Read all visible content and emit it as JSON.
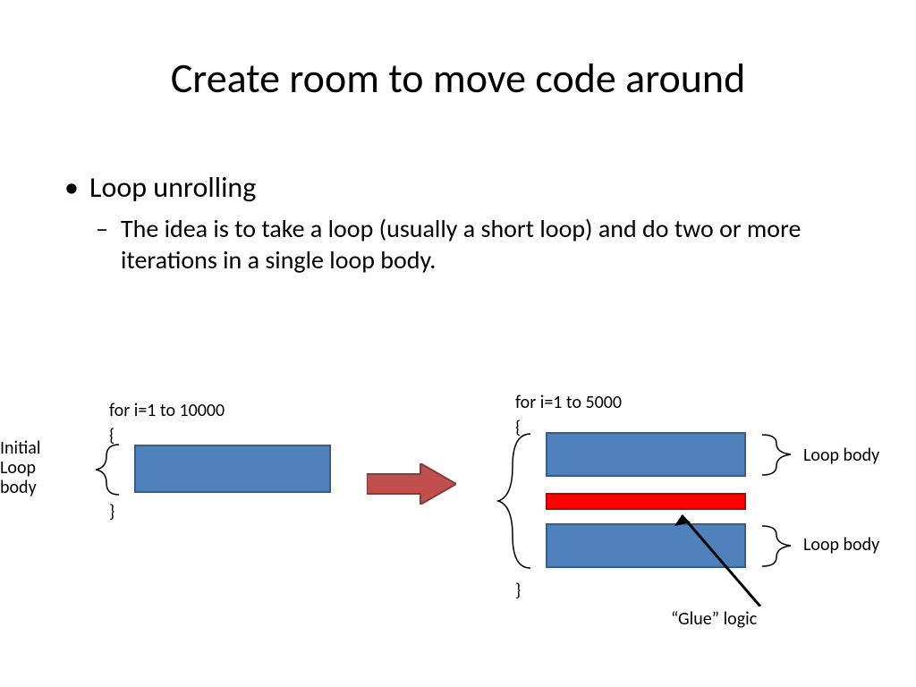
{
  "title": "Create room to move code around",
  "bullets": {
    "main": "Loop unrolling",
    "sub": "The idea is to take a loop (usually a short loop) and do two or more iterations in a single loop body."
  },
  "left": {
    "for_line": "for i=1 to 10000",
    "open_brace": "{",
    "close_brace": "}",
    "label": "Initial Loop body"
  },
  "right": {
    "for_line": "for i=1 to 5000",
    "open_brace": "{",
    "close_brace": "}",
    "label_top": "Loop body",
    "label_bot": "Loop body",
    "glue_label": "“Glue” logic"
  },
  "colors": {
    "box_fill": "#4f81bd",
    "box_stroke": "#385d8a",
    "glue_fill": "#ff0000",
    "arrow_fill": "#c0504d"
  }
}
